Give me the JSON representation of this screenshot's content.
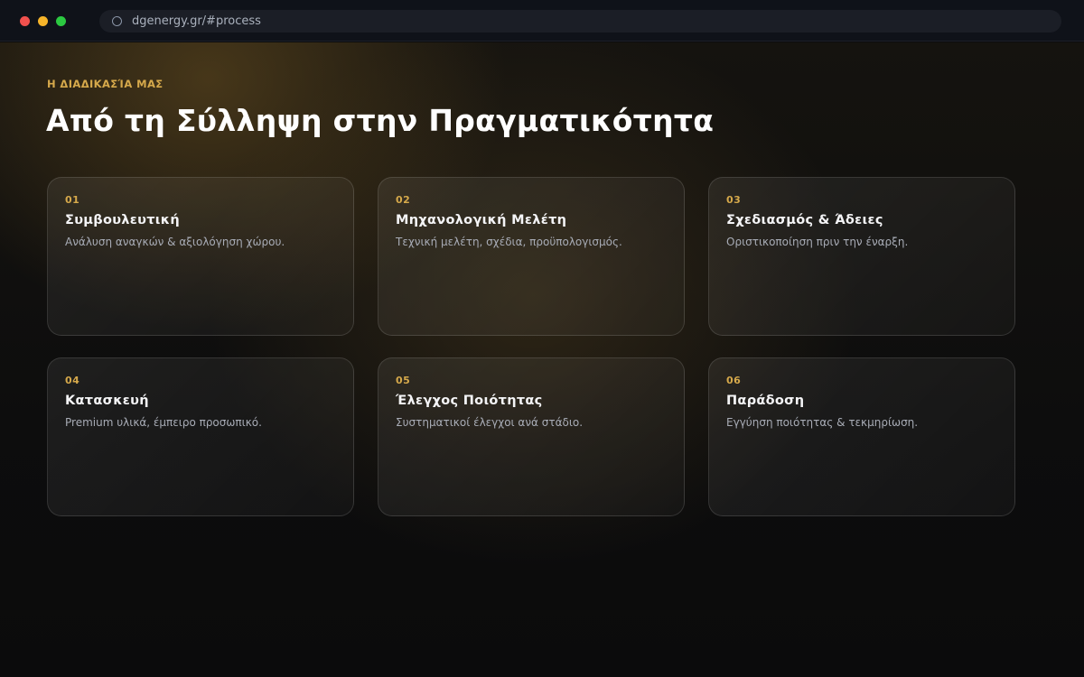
{
  "browser": {
    "url": "dgenergy.gr/#process"
  },
  "section": {
    "eyebrow": "Η ΔΙΑΔΙΚΑΣΊΑ ΜΑΣ",
    "heading": "Από τη Σύλληψη στην Πραγματικότητα"
  },
  "steps": [
    {
      "num": "01",
      "title": "Συμβουλευτική",
      "desc": "Ανάλυση αναγκών & αξιολόγηση χώρου."
    },
    {
      "num": "02",
      "title": "Μηχανολογική Μελέτη",
      "desc": "Τεχνική μελέτη, σχέδια, προϋπολογισμός."
    },
    {
      "num": "03",
      "title": "Σχεδιασμός & Άδειες",
      "desc": "Οριστικοποίηση πριν την έναρξη."
    },
    {
      "num": "04",
      "title": "Κατασκευή",
      "desc": "Premium υλικά, έμπειρο προσωπικό."
    },
    {
      "num": "05",
      "title": "Έλεγχος Ποιότητας",
      "desc": "Συστηματικοί έλεγχοι ανά στάδιο."
    },
    {
      "num": "06",
      "title": "Παράδοση",
      "desc": "Εγγύηση ποιότητας & τεκμηρίωση."
    }
  ]
}
